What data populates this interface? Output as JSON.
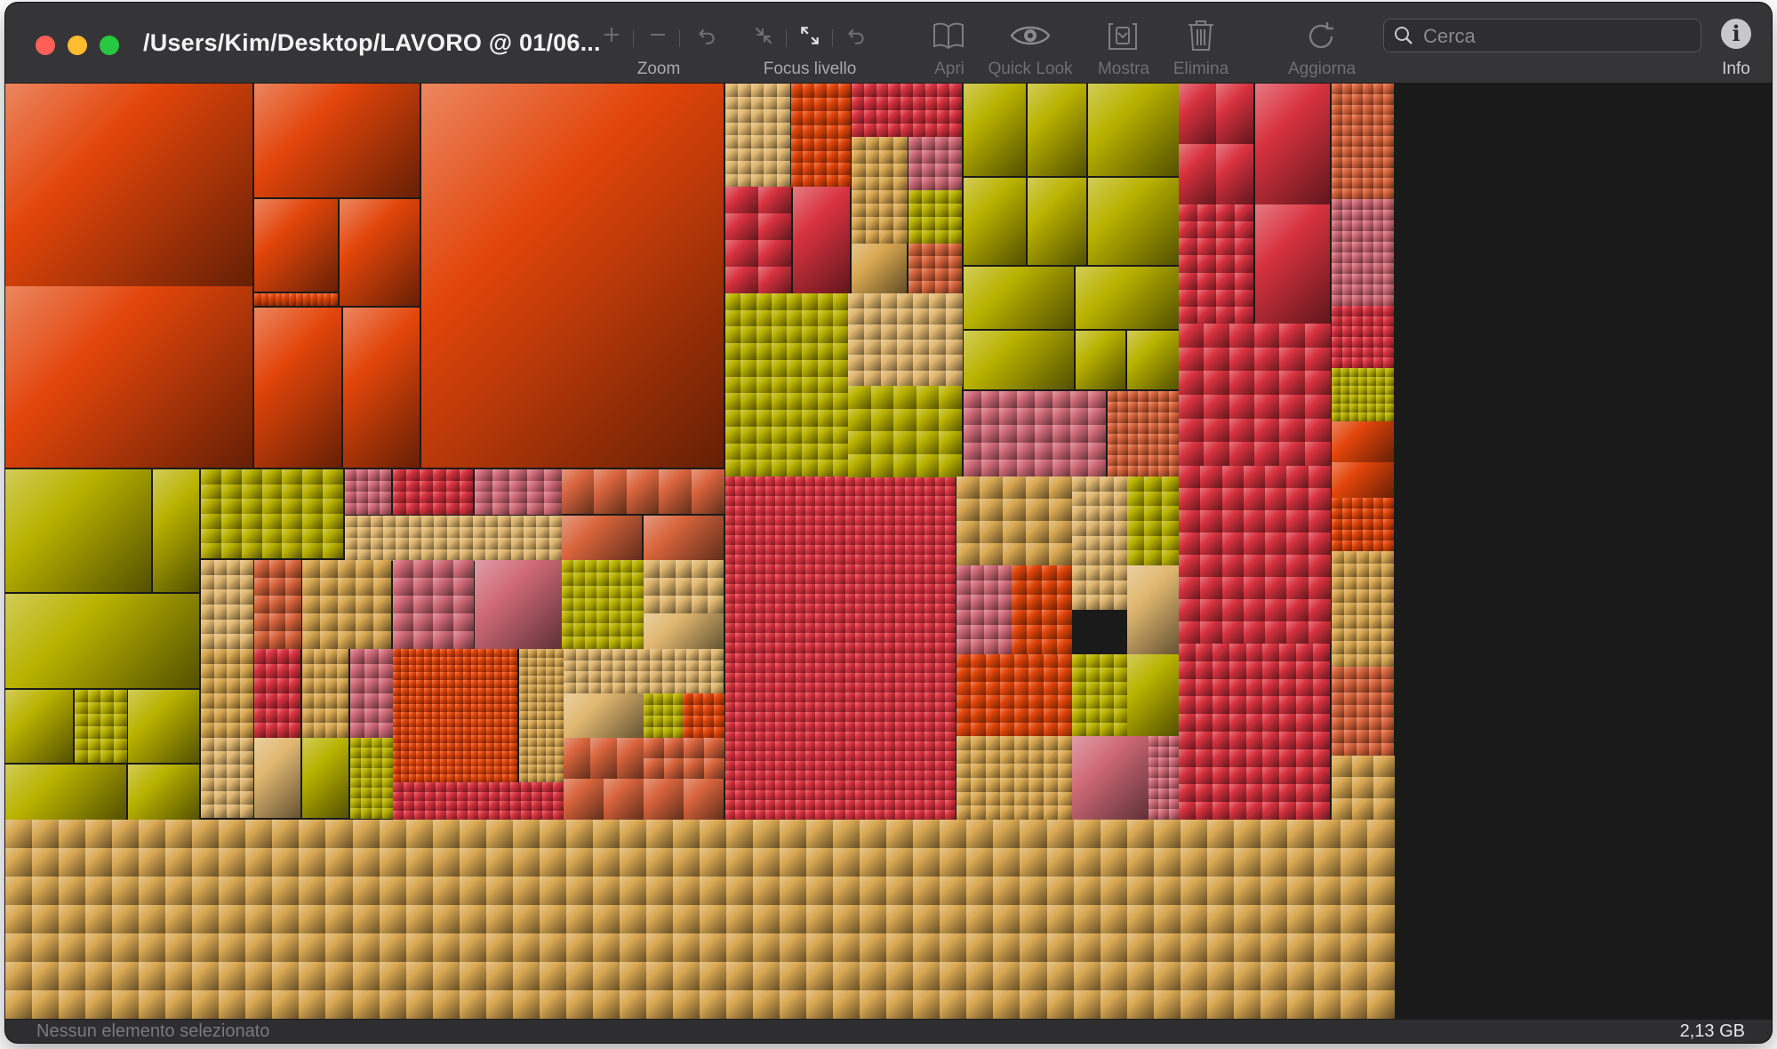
{
  "window": {
    "title": "/Users/Kim/Desktop/LAVORO @ 01/06..."
  },
  "toolbar": {
    "zoom_label": "Zoom",
    "focus_label": "Focus livello",
    "open_label": "Apri",
    "quicklook_label": "Quick Look",
    "show_label": "Mostra",
    "delete_label": "Elimina",
    "refresh_label": "Aggiorna",
    "info_label": "Info",
    "info_glyph": "i"
  },
  "search": {
    "placeholder": "Cerca"
  },
  "status": {
    "selection": "Nessun elemento selezionato",
    "total_size": "2,13 GB"
  },
  "colors": {
    "orange": "#e2450a",
    "olive": "#b9b200",
    "red": "#d8323f",
    "pink": "#d06a78",
    "gold": "#d9a852",
    "salmon": "#d8643c",
    "tan": "#e0b770"
  },
  "icons": [
    "zoom-in-icon",
    "zoom-out-icon",
    "undo-icon",
    "collapse-icon",
    "expand-icon",
    "redo-icon",
    "book-icon",
    "eye-icon",
    "reveal-icon",
    "trash-icon",
    "refresh-icon",
    "search-icon",
    "info-icon"
  ]
}
